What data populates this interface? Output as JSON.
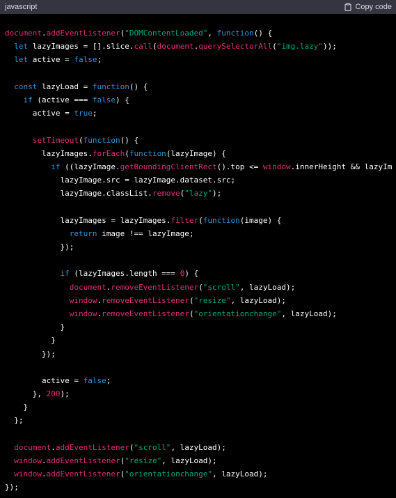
{
  "header": {
    "language": "javascript",
    "copy_label": "Copy code",
    "copy_icon": "clipboard-icon"
  },
  "colors": {
    "background": "#000000",
    "header_background": "#343541",
    "plain": "#ffffff",
    "keyword": "#2e95d3",
    "string": "#00a67d",
    "call": "#df3079",
    "number": "#df3079"
  },
  "code": {
    "lines": [
      [
        [
          "call",
          "document"
        ],
        [
          "plain",
          "."
        ],
        [
          "call",
          "addEventListener"
        ],
        [
          "plain",
          "("
        ],
        [
          "str",
          "\"DOMContentLoaded\""
        ],
        [
          "plain",
          ", "
        ],
        [
          "kw",
          "function"
        ],
        [
          "plain",
          "() {"
        ]
      ],
      [
        [
          "plain",
          "  "
        ],
        [
          "kw",
          "let"
        ],
        [
          "plain",
          " lazyImages = [].slice."
        ],
        [
          "call",
          "call"
        ],
        [
          "plain",
          "("
        ],
        [
          "call",
          "document"
        ],
        [
          "plain",
          "."
        ],
        [
          "call",
          "querySelectorAll"
        ],
        [
          "plain",
          "("
        ],
        [
          "str",
          "\"img.lazy\""
        ],
        [
          "plain",
          "));"
        ]
      ],
      [
        [
          "plain",
          "  "
        ],
        [
          "kw",
          "let"
        ],
        [
          "plain",
          " active = "
        ],
        [
          "kw",
          "false"
        ],
        [
          "plain",
          ";"
        ]
      ],
      [
        [
          "plain",
          ""
        ]
      ],
      [
        [
          "plain",
          "  "
        ],
        [
          "kw",
          "const"
        ],
        [
          "plain",
          " lazyLoad = "
        ],
        [
          "kw",
          "function"
        ],
        [
          "plain",
          "() {"
        ]
      ],
      [
        [
          "plain",
          "    "
        ],
        [
          "kw",
          "if"
        ],
        [
          "plain",
          " (active === "
        ],
        [
          "kw",
          "false"
        ],
        [
          "plain",
          ") {"
        ]
      ],
      [
        [
          "plain",
          "      active = "
        ],
        [
          "kw",
          "true"
        ],
        [
          "plain",
          ";"
        ]
      ],
      [
        [
          "plain",
          ""
        ]
      ],
      [
        [
          "plain",
          "      "
        ],
        [
          "call",
          "setTimeout"
        ],
        [
          "plain",
          "("
        ],
        [
          "kw",
          "function"
        ],
        [
          "plain",
          "() {"
        ]
      ],
      [
        [
          "plain",
          "        lazyImages."
        ],
        [
          "call",
          "forEach"
        ],
        [
          "plain",
          "("
        ],
        [
          "kw",
          "function"
        ],
        [
          "plain",
          "(lazyImage) {"
        ]
      ],
      [
        [
          "plain",
          "          "
        ],
        [
          "kw",
          "if"
        ],
        [
          "plain",
          " ((lazyImage."
        ],
        [
          "call",
          "getBoundingClientRect"
        ],
        [
          "plain",
          "().top <= "
        ],
        [
          "call",
          "window"
        ],
        [
          "plain",
          ".innerHeight && lazyIm"
        ]
      ],
      [
        [
          "plain",
          "            lazyImage.src = lazyImage.dataset.src;"
        ]
      ],
      [
        [
          "plain",
          "            lazyImage.classList."
        ],
        [
          "call",
          "remove"
        ],
        [
          "plain",
          "("
        ],
        [
          "str",
          "\"lazy\""
        ],
        [
          "plain",
          ");"
        ]
      ],
      [
        [
          "plain",
          ""
        ]
      ],
      [
        [
          "plain",
          "            lazyImages = lazyImages."
        ],
        [
          "call",
          "filter"
        ],
        [
          "plain",
          "("
        ],
        [
          "kw",
          "function"
        ],
        [
          "plain",
          "(image) {"
        ]
      ],
      [
        [
          "plain",
          "              "
        ],
        [
          "kw",
          "return"
        ],
        [
          "plain",
          " image !== lazyImage;"
        ]
      ],
      [
        [
          "plain",
          "            });"
        ]
      ],
      [
        [
          "plain",
          ""
        ]
      ],
      [
        [
          "plain",
          "            "
        ],
        [
          "kw",
          "if"
        ],
        [
          "plain",
          " (lazyImages.length === "
        ],
        [
          "num",
          "0"
        ],
        [
          "plain",
          ") {"
        ]
      ],
      [
        [
          "plain",
          "              "
        ],
        [
          "call",
          "document"
        ],
        [
          "plain",
          "."
        ],
        [
          "call",
          "removeEventListener"
        ],
        [
          "plain",
          "("
        ],
        [
          "str",
          "\"scroll\""
        ],
        [
          "plain",
          ", lazyLoad);"
        ]
      ],
      [
        [
          "plain",
          "              "
        ],
        [
          "call",
          "window"
        ],
        [
          "plain",
          "."
        ],
        [
          "call",
          "removeEventListener"
        ],
        [
          "plain",
          "("
        ],
        [
          "str",
          "\"resize\""
        ],
        [
          "plain",
          ", lazyLoad);"
        ]
      ],
      [
        [
          "plain",
          "              "
        ],
        [
          "call",
          "window"
        ],
        [
          "plain",
          "."
        ],
        [
          "call",
          "removeEventListener"
        ],
        [
          "plain",
          "("
        ],
        [
          "str",
          "\"orientationchange\""
        ],
        [
          "plain",
          ", lazyLoad);"
        ]
      ],
      [
        [
          "plain",
          "            }"
        ]
      ],
      [
        [
          "plain",
          "          }"
        ]
      ],
      [
        [
          "plain",
          "        });"
        ]
      ],
      [
        [
          "plain",
          ""
        ]
      ],
      [
        [
          "plain",
          "        active = "
        ],
        [
          "kw",
          "false"
        ],
        [
          "plain",
          ";"
        ]
      ],
      [
        [
          "plain",
          "      }, "
        ],
        [
          "num",
          "200"
        ],
        [
          "plain",
          ");"
        ]
      ],
      [
        [
          "plain",
          "    }"
        ]
      ],
      [
        [
          "plain",
          "  };"
        ]
      ],
      [
        [
          "plain",
          ""
        ]
      ],
      [
        [
          "plain",
          "  "
        ],
        [
          "call",
          "document"
        ],
        [
          "plain",
          "."
        ],
        [
          "call",
          "addEventListener"
        ],
        [
          "plain",
          "("
        ],
        [
          "str",
          "\"scroll\""
        ],
        [
          "plain",
          ", lazyLoad);"
        ]
      ],
      [
        [
          "plain",
          "  "
        ],
        [
          "call",
          "window"
        ],
        [
          "plain",
          "."
        ],
        [
          "call",
          "addEventListener"
        ],
        [
          "plain",
          "("
        ],
        [
          "str",
          "\"resize\""
        ],
        [
          "plain",
          ", lazyLoad);"
        ]
      ],
      [
        [
          "plain",
          "  "
        ],
        [
          "call",
          "window"
        ],
        [
          "plain",
          "."
        ],
        [
          "call",
          "addEventListener"
        ],
        [
          "plain",
          "("
        ],
        [
          "str",
          "\"orientationchange\""
        ],
        [
          "plain",
          ", lazyLoad);"
        ]
      ],
      [
        [
          "plain",
          "});"
        ]
      ]
    ]
  }
}
